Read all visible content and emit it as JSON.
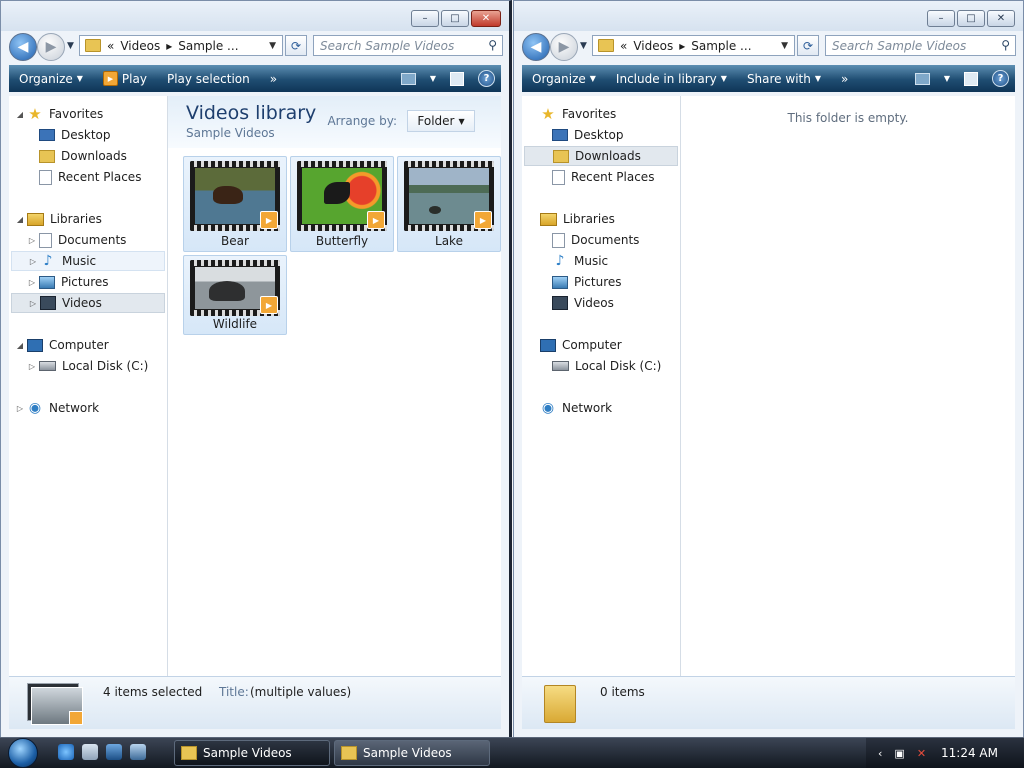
{
  "caption_buttons": {
    "minimize": "–",
    "maximize": "□",
    "close": "✕"
  },
  "left": {
    "address": [
      "«",
      "Videos",
      "▸",
      "Sample ..."
    ],
    "search_placeholder": "Search Sample Videos",
    "toolbar": {
      "organize": "Organize",
      "play": "Play",
      "play_selection": "Play selection",
      "more": "»"
    },
    "nav": {
      "favorites": "Favorites",
      "desktop": "Desktop",
      "downloads": "Downloads",
      "recent": "Recent Places",
      "libraries": "Libraries",
      "documents": "Documents",
      "music": "Music",
      "pictures": "Pictures",
      "videos": "Videos",
      "computer": "Computer",
      "localdisk": "Local Disk (C:)",
      "network": "Network"
    },
    "library_title": "Videos library",
    "library_subtitle": "Sample Videos",
    "arrange_label": "Arrange by:",
    "arrange_value": "Folder",
    "items": [
      "Bear",
      "Butterfly",
      "Lake",
      "Wildlife"
    ],
    "details": {
      "count": "4 items selected",
      "title_label": "Title:",
      "title_value": "(multiple values)"
    }
  },
  "right": {
    "address": [
      "«",
      "Videos",
      "▸",
      "Sample ..."
    ],
    "search_placeholder": "Search Sample Videos",
    "toolbar": {
      "organize": "Organize",
      "include": "Include in library",
      "share": "Share with",
      "more": "»"
    },
    "nav": {
      "favorites": "Favorites",
      "desktop": "Desktop",
      "downloads": "Downloads",
      "recent": "Recent Places",
      "libraries": "Libraries",
      "documents": "Documents",
      "music": "Music",
      "pictures": "Pictures",
      "videos": "Videos",
      "computer": "Computer",
      "localdisk": "Local Disk (C:)",
      "network": "Network"
    },
    "empty_text": "This folder is empty.",
    "details": {
      "count": "0 items"
    }
  },
  "taskbar": {
    "tasks": [
      "Sample Videos",
      "Sample Videos"
    ],
    "time": "11:24 AM"
  },
  "colors": {
    "toolbar": "#1f4d72",
    "accent": "#1e3f6e",
    "taskbar": "#121820"
  }
}
